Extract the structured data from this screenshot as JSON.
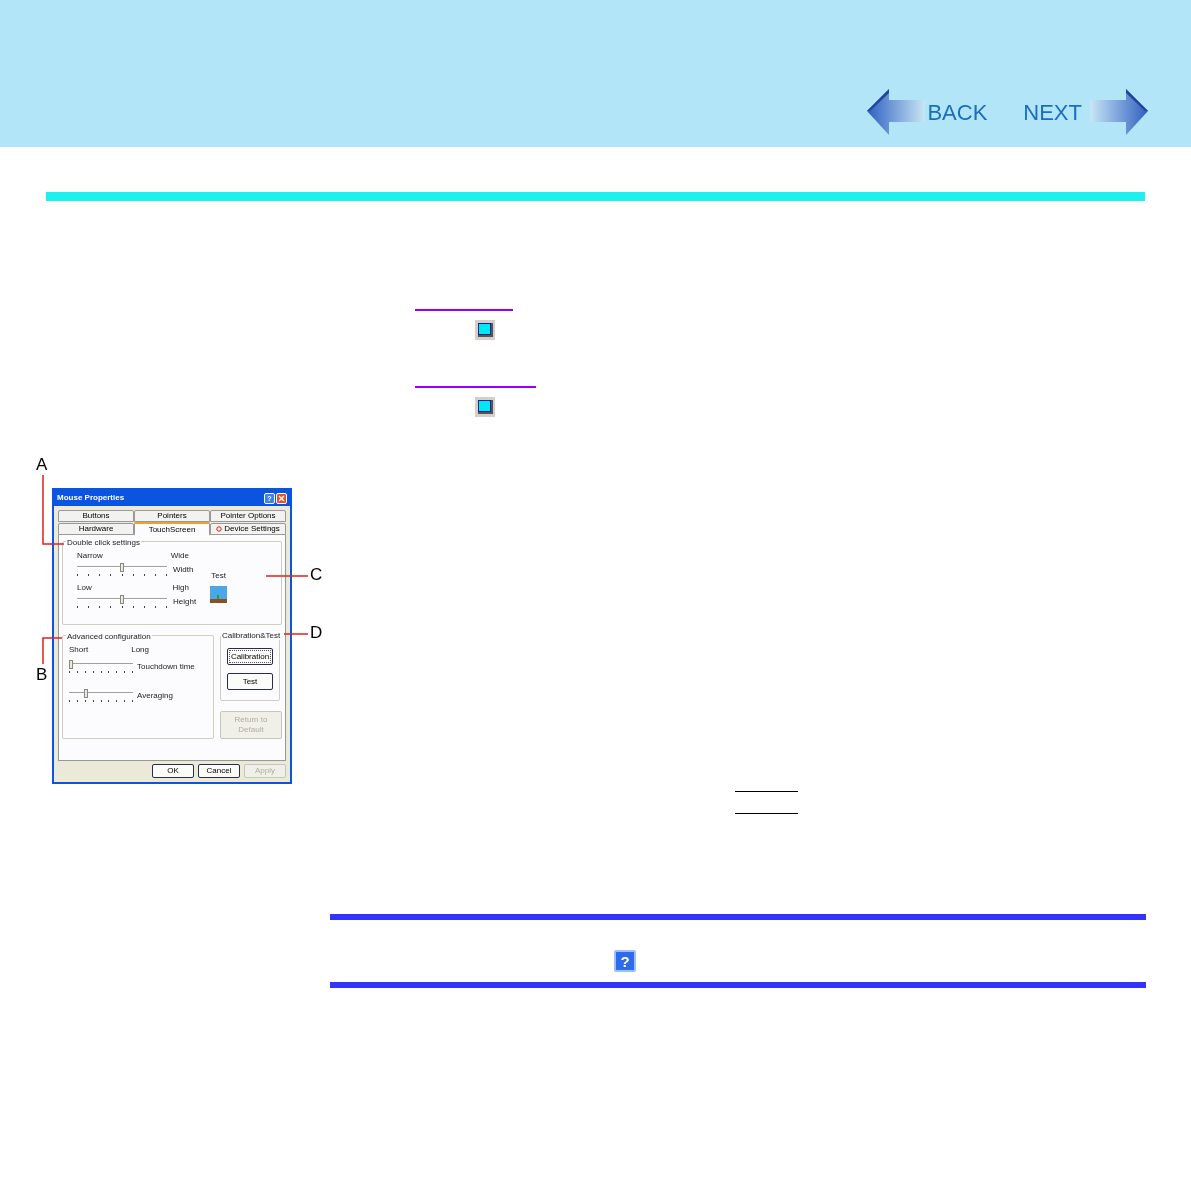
{
  "nav": {
    "back": "BACK",
    "next": "NEXT"
  },
  "dialog": {
    "title": "Mouse Properties",
    "help_button": "?",
    "tabs_row1": [
      {
        "label": "Buttons",
        "selected": false
      },
      {
        "label": "Pointers",
        "selected": false
      },
      {
        "label": "Pointer Options",
        "selected": false
      }
    ],
    "tabs_row2": [
      {
        "label": "Hardware",
        "selected": false
      },
      {
        "label": "TouchScreen",
        "selected": true
      },
      {
        "label": "Device Settings",
        "selected": false
      }
    ],
    "double_click": {
      "title": "Double click settings",
      "test_label": "Test",
      "sliders": [
        {
          "left": "Narrow",
          "right": "Wide",
          "label": "Width",
          "level": 0.5
        },
        {
          "left": "Low",
          "right": "High",
          "label": "Height",
          "level": 0.5
        }
      ]
    },
    "advanced": {
      "title": "Advanced configuration",
      "sliders": [
        {
          "left": "Short",
          "right": "Long",
          "label": "Touchdown time",
          "level": 0
        },
        {
          "label": "Averaging",
          "level": 0.25
        }
      ]
    },
    "calibration": {
      "title": "Calibration&Test",
      "buttons": [
        {
          "label": "Calibration",
          "disabled": false,
          "focused": true
        },
        {
          "label": "Test",
          "disabled": false,
          "focused": false
        }
      ]
    },
    "return_button": {
      "label": "Return to Default",
      "disabled": true
    },
    "buttons": [
      {
        "label": "OK",
        "disabled": false
      },
      {
        "label": "Cancel",
        "disabled": false
      },
      {
        "label": "Apply",
        "disabled": true
      }
    ]
  },
  "callouts": [
    "A",
    "B",
    "C",
    "D"
  ],
  "help_button": "?"
}
